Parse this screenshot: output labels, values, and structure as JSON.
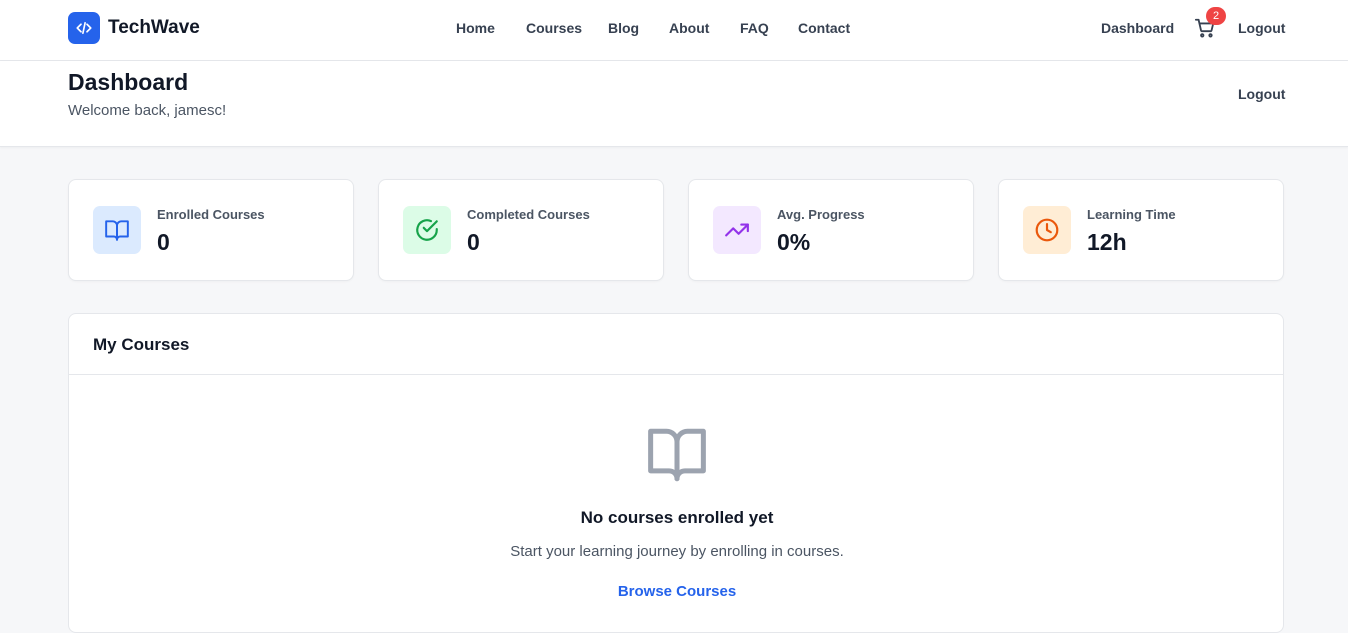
{
  "brand": {
    "name": "TechWave",
    "icon": "code-icon",
    "color": "#2563eb"
  },
  "nav": {
    "links": [
      {
        "label": "Home"
      },
      {
        "label": "Courses"
      },
      {
        "label": "Blog"
      },
      {
        "label": "About"
      },
      {
        "label": "FAQ"
      },
      {
        "label": "Contact"
      }
    ],
    "dashboard_label": "Dashboard",
    "cart_count": "2",
    "logout_label": "Logout"
  },
  "header": {
    "title": "Dashboard",
    "welcome": "Welcome back, jamesc!",
    "logout_label": "Logout"
  },
  "stats": [
    {
      "label": "Enrolled Courses",
      "value": "0",
      "icon": "book-open-icon",
      "bg": "#dbeafe",
      "fg": "#2563eb"
    },
    {
      "label": "Completed Courses",
      "value": "0",
      "icon": "check-circle-icon",
      "bg": "#dcfce7",
      "fg": "#16a34a"
    },
    {
      "label": "Avg. Progress",
      "value": "0%",
      "icon": "trending-up-icon",
      "bg": "#f3e8ff",
      "fg": "#9333ea"
    },
    {
      "label": "Learning Time",
      "value": "12h",
      "icon": "clock-icon",
      "bg": "#ffedd5",
      "fg": "#ea580c"
    }
  ],
  "courses": {
    "title": "My Courses",
    "empty_icon": "book-open-icon",
    "empty_title": "No courses enrolled yet",
    "empty_subtitle": "Start your learning journey by enrolling in courses.",
    "browse_label": "Browse Courses"
  }
}
